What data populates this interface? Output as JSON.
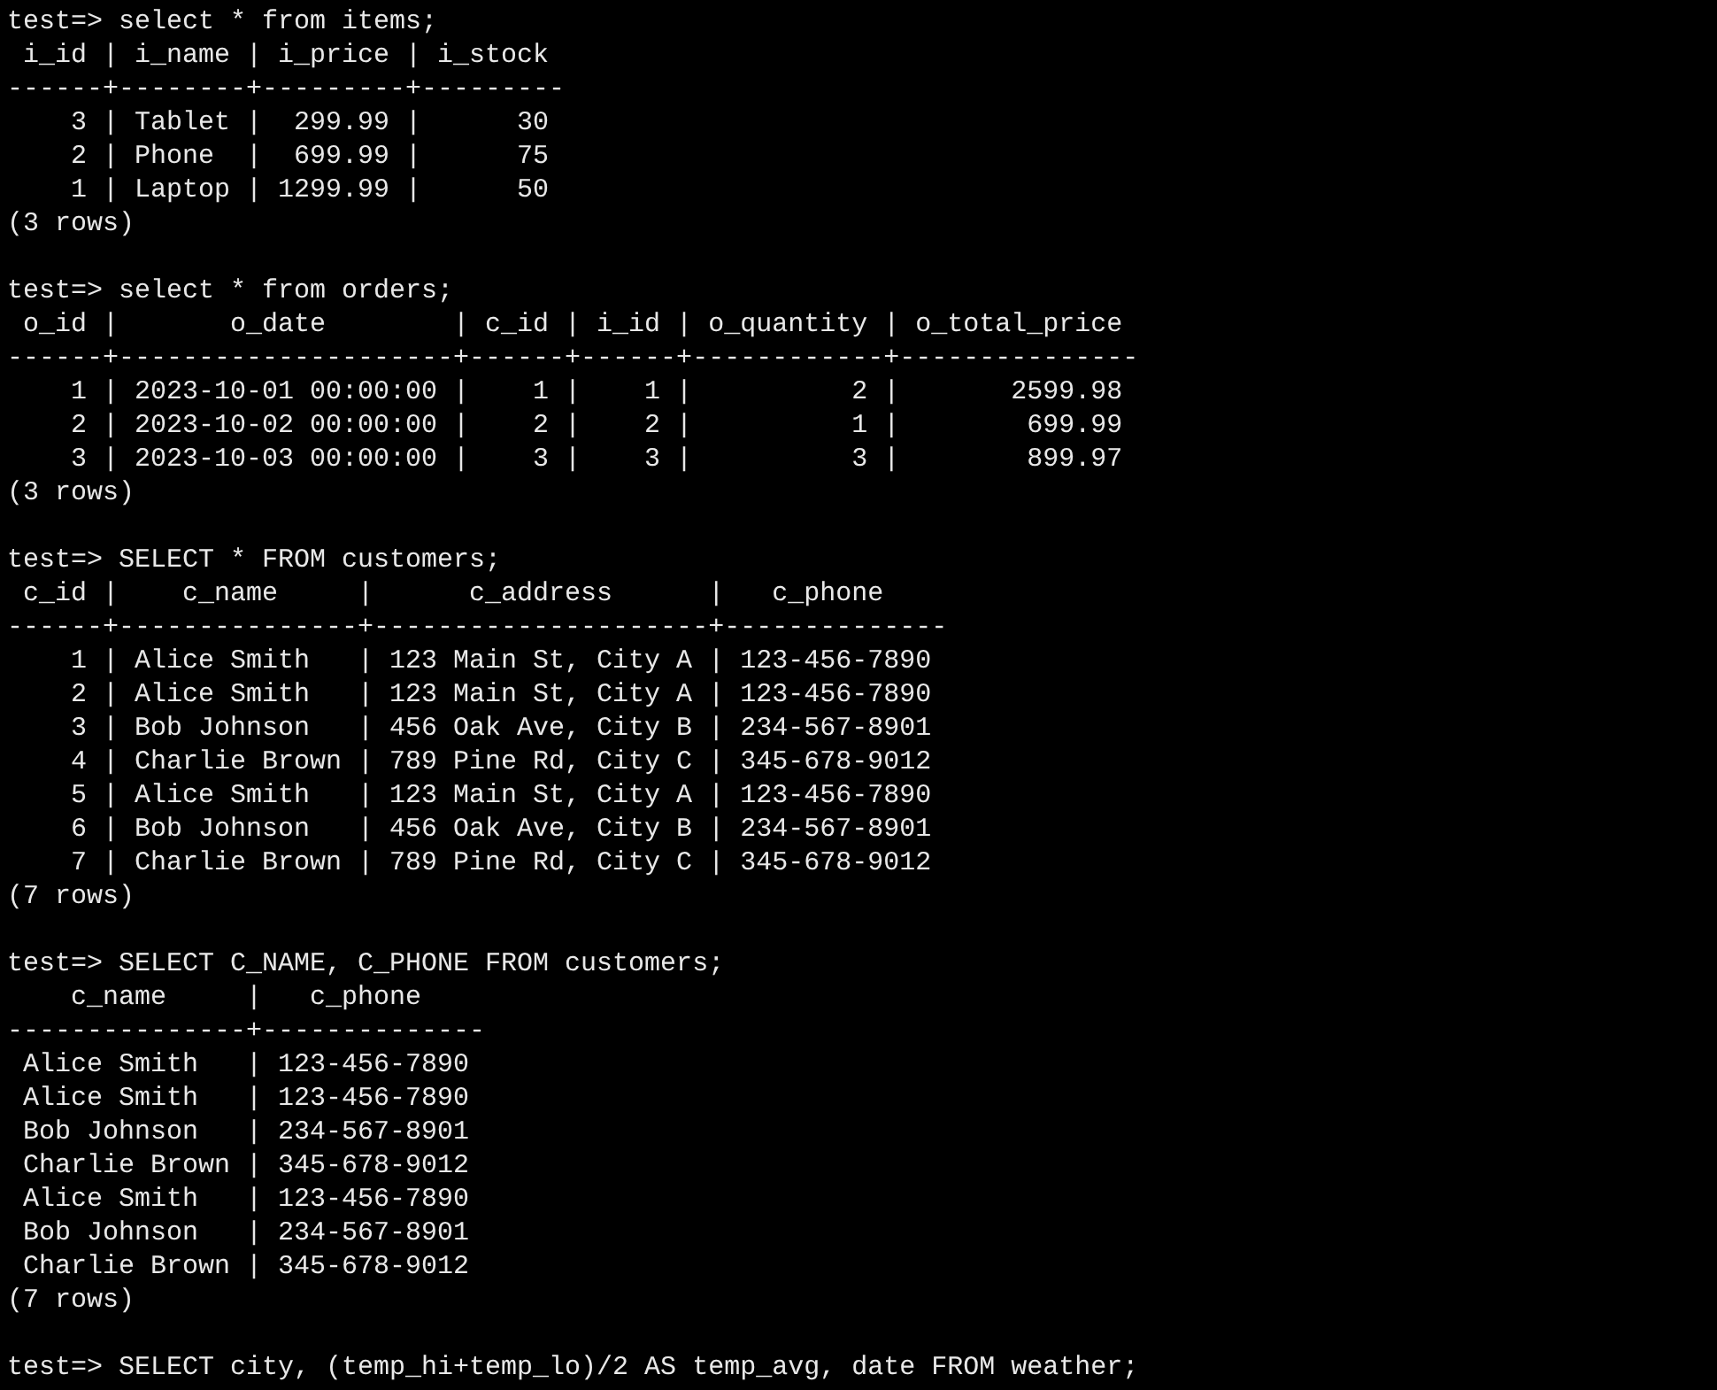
{
  "terminal": {
    "blocks": [
      {
        "command": "test=> select * from items;",
        "lines": [
          " i_id | i_name | i_price | i_stock",
          "------+--------+---------+---------",
          "    3 | Tablet |  299.99 |      30",
          "    2 | Phone  |  699.99 |      75",
          "    1 | Laptop | 1299.99 |      50",
          "(3 rows)"
        ]
      },
      {
        "command": "test=> select * from orders;",
        "lines": [
          " o_id |       o_date        | c_id | i_id | o_quantity | o_total_price",
          "------+---------------------+------+------+------------+---------------",
          "    1 | 2023-10-01 00:00:00 |    1 |    1 |          2 |       2599.98",
          "    2 | 2023-10-02 00:00:00 |    2 |    2 |          1 |        699.99",
          "    3 | 2023-10-03 00:00:00 |    3 |    3 |          3 |        899.97",
          "(3 rows)"
        ]
      },
      {
        "command": "test=> SELECT * FROM customers;",
        "lines": [
          " c_id |    c_name     |      c_address      |   c_phone",
          "------+---------------+---------------------+--------------",
          "    1 | Alice Smith   | 123 Main St, City A | 123-456-7890",
          "    2 | Alice Smith   | 123 Main St, City A | 123-456-7890",
          "    3 | Bob Johnson   | 456 Oak Ave, City B | 234-567-8901",
          "    4 | Charlie Brown | 789 Pine Rd, City C | 345-678-9012",
          "    5 | Alice Smith   | 123 Main St, City A | 123-456-7890",
          "    6 | Bob Johnson   | 456 Oak Ave, City B | 234-567-8901",
          "    7 | Charlie Brown | 789 Pine Rd, City C | 345-678-9012",
          "(7 rows)"
        ]
      },
      {
        "command": "test=> SELECT C_NAME, C_PHONE FROM customers;",
        "lines": [
          "    c_name     |   c_phone",
          "---------------+--------------",
          " Alice Smith   | 123-456-7890",
          " Alice Smith   | 123-456-7890",
          " Bob Johnson   | 234-567-8901",
          " Charlie Brown | 345-678-9012",
          " Alice Smith   | 123-456-7890",
          " Bob Johnson   | 234-567-8901",
          " Charlie Brown | 345-678-9012",
          "(7 rows)"
        ]
      },
      {
        "command": "test=> SELECT city, (temp_hi+temp_lo)/2 AS temp_avg, date FROM weather;"
      }
    ]
  }
}
